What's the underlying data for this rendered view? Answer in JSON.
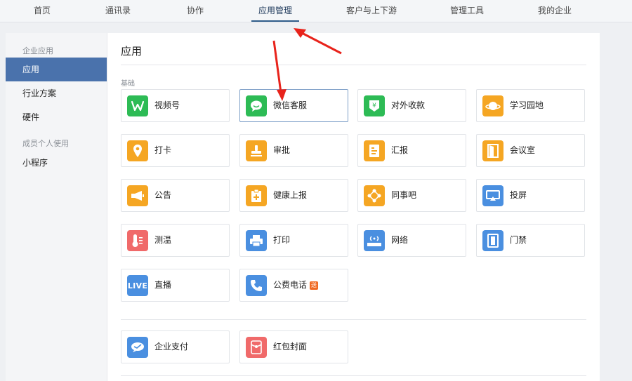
{
  "top_nav": {
    "items": [
      "首页",
      "通讯录",
      "协作",
      "应用管理",
      "客户与上下游",
      "管理工具",
      "我的企业"
    ],
    "active_index": 3
  },
  "sidebar": {
    "section_enterprise": "企业应用",
    "items_enterprise": [
      "应用",
      "行业方案",
      "硬件"
    ],
    "section_member": "成员个人使用",
    "items_member": [
      "小程序"
    ],
    "active": "应用"
  },
  "main": {
    "title": "应用",
    "group_basic": "基础",
    "apps": [
      {
        "label": "视频号",
        "icon": "video-channel-icon",
        "color": "#2dbb55"
      },
      {
        "label": "微信客服",
        "icon": "wechat-service-icon",
        "color": "#2dbb55"
      },
      {
        "label": "对外收款",
        "icon": "payment-icon",
        "color": "#2dbb55"
      },
      {
        "label": "学习园地",
        "icon": "planet-icon",
        "color": "#f5a623"
      },
      {
        "label": "打卡",
        "icon": "location-pin-icon",
        "color": "#f5a623"
      },
      {
        "label": "审批",
        "icon": "stamp-icon",
        "color": "#f5a623"
      },
      {
        "label": "汇报",
        "icon": "report-icon",
        "color": "#f5a623"
      },
      {
        "label": "会议室",
        "icon": "door-icon",
        "color": "#f5a623"
      },
      {
        "label": "公告",
        "icon": "megaphone-icon",
        "color": "#f5a623"
      },
      {
        "label": "健康上报",
        "icon": "health-clipboard-icon",
        "color": "#f5a623"
      },
      {
        "label": "同事吧",
        "icon": "diamond-nodes-icon",
        "color": "#f5a623"
      },
      {
        "label": "投屏",
        "icon": "screen-cast-icon",
        "color": "#4a8fe0"
      },
      {
        "label": "测温",
        "icon": "thermometer-icon",
        "color": "#f06a6a"
      },
      {
        "label": "打印",
        "icon": "printer-icon",
        "color": "#4a8fe0"
      },
      {
        "label": "网络",
        "icon": "wifi-router-icon",
        "color": "#4a8fe0"
      },
      {
        "label": "门禁",
        "icon": "door-access-icon",
        "color": "#4a8fe0"
      },
      {
        "label": "直播",
        "icon": "live-icon",
        "icon_text": "LIVE",
        "color": "#4a8fe0"
      },
      {
        "label": "公费电话",
        "icon": "phone-icon",
        "color": "#4a8fe0",
        "tag": "送"
      }
    ],
    "extra_apps": [
      {
        "label": "企业支付",
        "icon": "enterprise-pay-icon",
        "color": "#4a8fe0"
      },
      {
        "label": "红包封面",
        "icon": "red-envelope-icon",
        "color": "#f06a6a"
      }
    ],
    "highlighted_app": "微信客服"
  },
  "annotation": {
    "arrow_color": "#e8231b"
  }
}
